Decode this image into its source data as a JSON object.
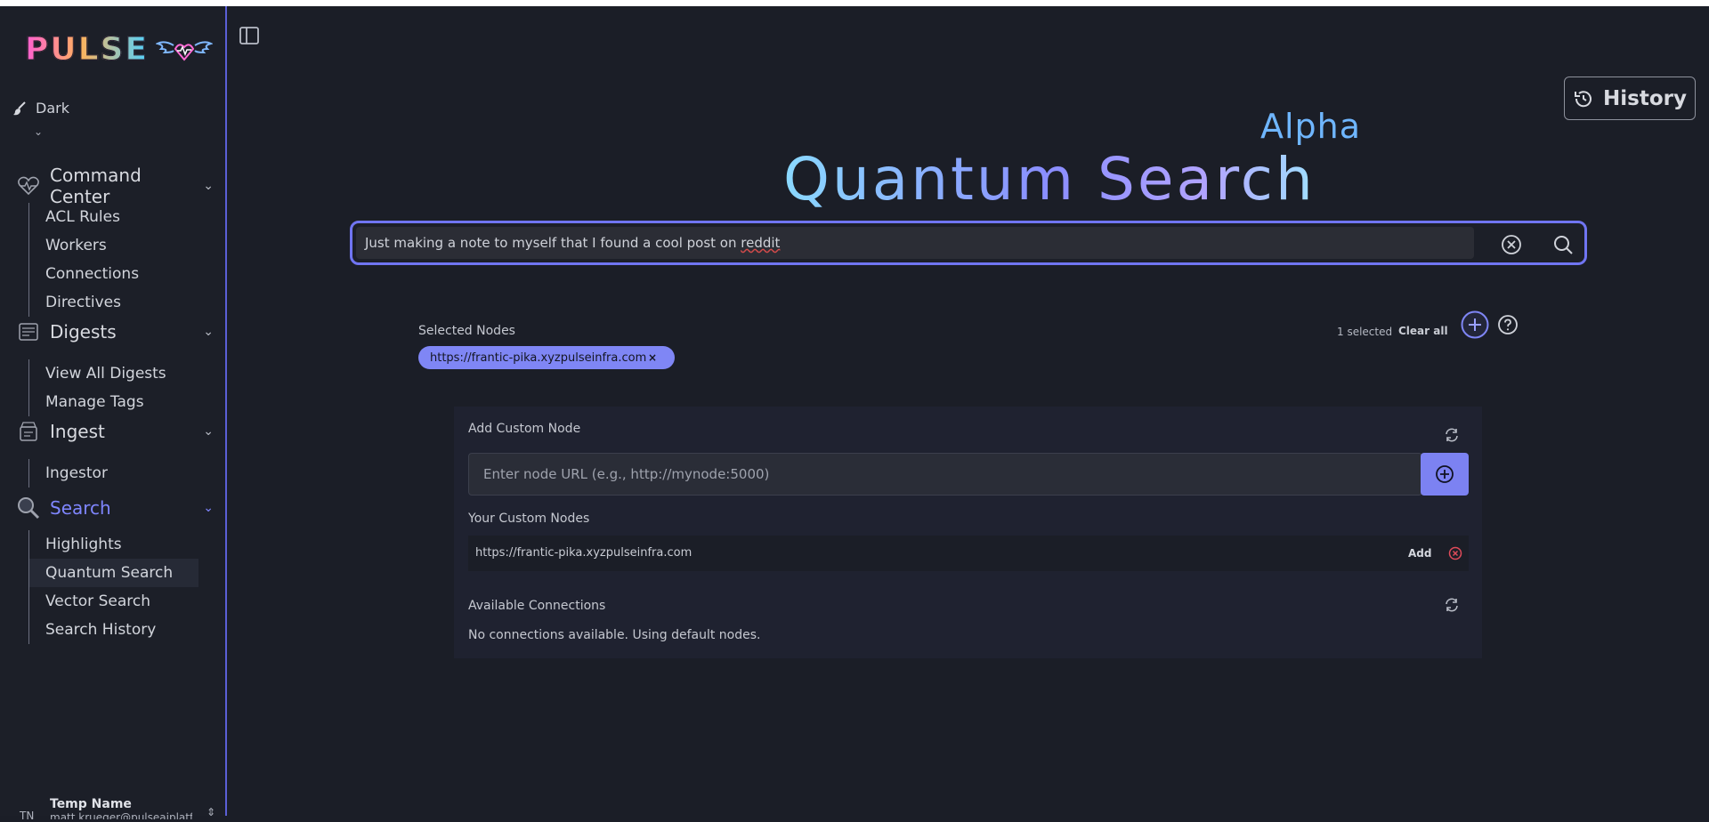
{
  "brand": {
    "logo_text": "PULSE"
  },
  "theme": {
    "label": "Dark"
  },
  "nav": {
    "sections": [
      {
        "label": "Command Center",
        "items": [
          "ACL Rules",
          "Workers",
          "Connections",
          "Directives"
        ]
      },
      {
        "label": "Digests",
        "items": [
          "View All Digests",
          "Manage Tags"
        ]
      },
      {
        "label": "Ingest",
        "items": [
          "Ingestor"
        ]
      },
      {
        "label": "Search",
        "items": [
          "Highlights",
          "Quantum Search",
          "Vector Search",
          "Search History"
        ]
      }
    ],
    "active_item": "Quantum Search"
  },
  "user": {
    "initials": "TN",
    "name": "Temp Name",
    "email": "matt.krueger@pulseaiplatf"
  },
  "header": {
    "history_label": "History",
    "badge": "Alpha",
    "title": "Quantum Search"
  },
  "search": {
    "query_text": "Just making a note to myself that I found a cool post on ",
    "query_tail": "reddit"
  },
  "selected_nodes": {
    "label": "Selected Nodes",
    "count_text": "1 selected",
    "clear_label": "Clear all",
    "chips": [
      {
        "url": "https://frantic-pika.xyzpulseinfra.com",
        "remove": "×"
      }
    ]
  },
  "custom_node": {
    "heading": "Add Custom Node",
    "placeholder": "Enter node URL (e.g., http://mynode:5000)",
    "your_nodes_heading": "Your Custom Nodes",
    "nodes": [
      {
        "url": "https://frantic-pika.xyzpulseinfra.com",
        "add_label": "Add"
      }
    ],
    "available_heading": "Available Connections",
    "available_message": "No connections available. Using default nodes."
  },
  "colors": {
    "accent": "#7f86f5",
    "danger": "#e04b5a",
    "background": "#1b1e27"
  }
}
